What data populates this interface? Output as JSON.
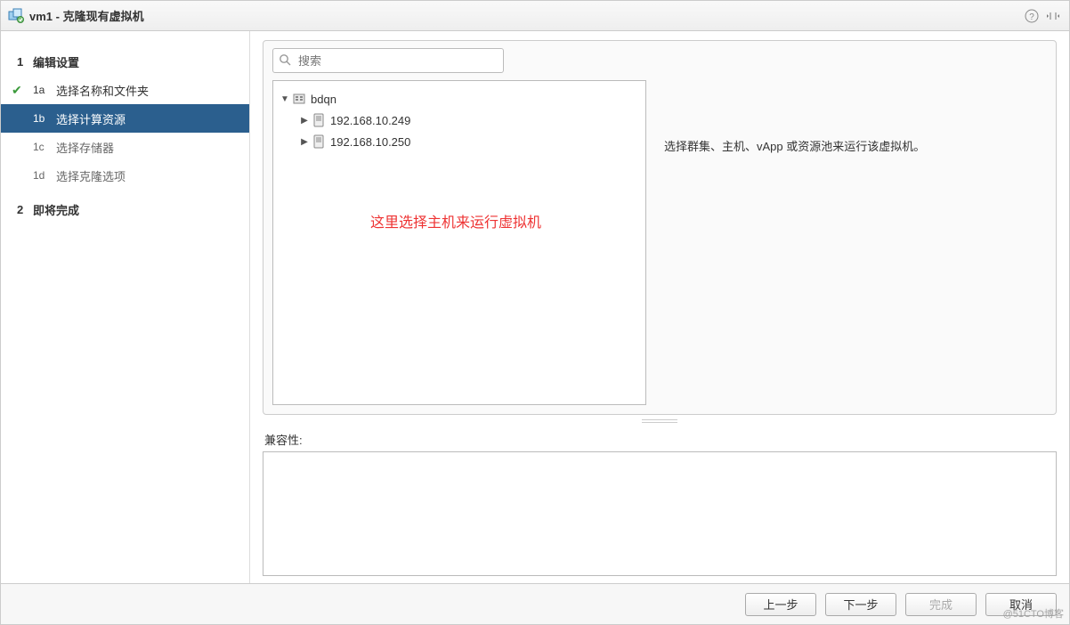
{
  "title": "vm1 - 克隆现有虚拟机",
  "sidebar": {
    "steps": [
      {
        "num": "1",
        "label": "编辑设置",
        "type": "major"
      },
      {
        "num": "1a",
        "label": "选择名称和文件夹",
        "type": "sub",
        "done": true
      },
      {
        "num": "1b",
        "label": "选择计算资源",
        "type": "sub",
        "active": true
      },
      {
        "num": "1c",
        "label": "选择存储器",
        "type": "sub"
      },
      {
        "num": "1d",
        "label": "选择克隆选项",
        "type": "sub"
      },
      {
        "num": "2",
        "label": "即将完成",
        "type": "major"
      }
    ]
  },
  "search": {
    "placeholder": "搜索"
  },
  "tree": {
    "root": {
      "label": "bdqn"
    },
    "hosts": [
      {
        "label": "192.168.10.249"
      },
      {
        "label": "192.168.10.250"
      }
    ]
  },
  "annotation": "这里选择主机来运行虚拟机",
  "hint": "选择群集、主机、vApp 或资源池来运行该虚拟机。",
  "compat_label": "兼容性:",
  "buttons": {
    "back": "上一步",
    "next": "下一步",
    "finish": "完成",
    "cancel": "取消"
  },
  "watermark": "@51CTO博客"
}
